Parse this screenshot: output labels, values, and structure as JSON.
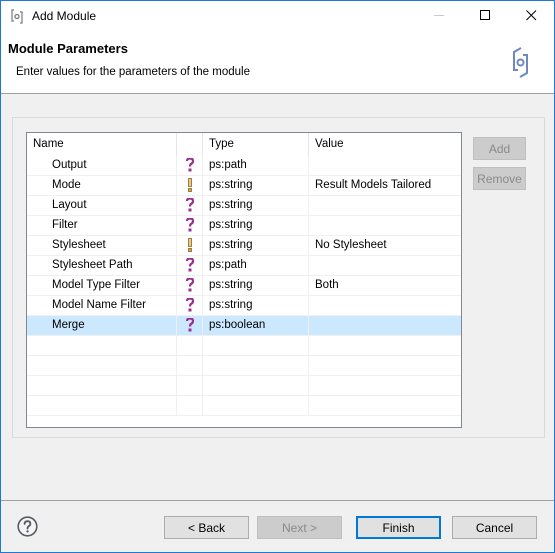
{
  "window": {
    "title": "Add Module",
    "app_icon": "module-icon",
    "controls": [
      "minimize-icon",
      "maximize-icon",
      "close-icon"
    ]
  },
  "banner": {
    "title": "Module Parameters",
    "description": "Enter values for the parameters of the module",
    "graphic": "module-refresh-icon"
  },
  "table": {
    "columns": [
      "Name",
      "",
      "Type",
      "Value"
    ],
    "rows": [
      {
        "name": "Output",
        "icon": "optional",
        "type": "ps:path",
        "value": "",
        "selected": false
      },
      {
        "name": "Mode",
        "icon": "required",
        "type": "ps:string",
        "value": "Result Models Tailored",
        "selected": false
      },
      {
        "name": "Layout",
        "icon": "optional",
        "type": "ps:string",
        "value": "",
        "selected": false
      },
      {
        "name": "Filter",
        "icon": "optional",
        "type": "ps:string",
        "value": "",
        "selected": false
      },
      {
        "name": "Stylesheet",
        "icon": "required",
        "type": "ps:string",
        "value": "No Stylesheet",
        "selected": false
      },
      {
        "name": "Stylesheet Path",
        "icon": "optional",
        "type": "ps:path",
        "value": "",
        "selected": false
      },
      {
        "name": "Model Type Filter",
        "icon": "optional",
        "type": "ps:string",
        "value": "Both",
        "selected": false
      },
      {
        "name": "Model Name Filter",
        "icon": "optional",
        "type": "ps:string",
        "value": "",
        "selected": false
      },
      {
        "name": "Merge",
        "icon": "optional",
        "type": "ps:boolean",
        "value": "",
        "selected": true
      }
    ],
    "empty_rows": 4
  },
  "side_buttons": {
    "add": "Add",
    "remove": "Remove"
  },
  "footer": {
    "help_icon": "help-icon",
    "back": "< Back",
    "next": "Next >",
    "finish": "Finish",
    "cancel": "Cancel"
  },
  "colors": {
    "window_border": "#1a7ad4",
    "selection": "#cce8ff",
    "optional_icon": "#9b2f8e",
    "required_icon": "#d9a441",
    "default_button_border": "#0078d7"
  }
}
